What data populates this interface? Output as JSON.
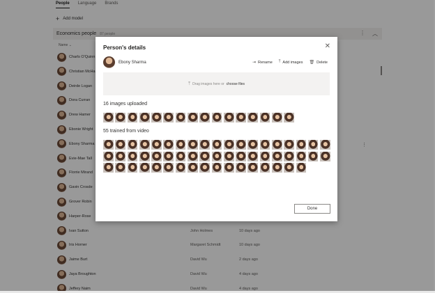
{
  "tabs": [
    {
      "label": "People",
      "active": true
    },
    {
      "label": "Language",
      "active": false
    },
    {
      "label": "Brands",
      "active": false
    }
  ],
  "add_model_label": "Add model",
  "group": {
    "title": "Economics people",
    "count": "87 people"
  },
  "column_header": "Name",
  "people": [
    {
      "name": "Charls O'Quinn",
      "owner": "",
      "when": ""
    },
    {
      "name": "Christian McHa",
      "owner": "",
      "when": ""
    },
    {
      "name": "Deirde Logan",
      "owner": "",
      "when": ""
    },
    {
      "name": "Dora Curran",
      "owner": "",
      "when": ""
    },
    {
      "name": "Drew Hamer",
      "owner": "",
      "when": ""
    },
    {
      "name": "Ebonie Wright",
      "owner": "",
      "when": ""
    },
    {
      "name": "Ebony Sharma",
      "owner": "",
      "when": ""
    },
    {
      "name": "Evie-Mae Tall",
      "owner": "",
      "when": ""
    },
    {
      "name": "Florrie Mirand",
      "owner": "",
      "when": ""
    },
    {
      "name": "Gavin Crosde",
      "owner": "",
      "when": ""
    },
    {
      "name": "Grover Robin",
      "owner": "",
      "when": ""
    },
    {
      "name": "Harper-Rose",
      "owner": "",
      "when": ""
    },
    {
      "name": "Ivan Sutton",
      "owner": "John Holmes",
      "when": "10 days ago"
    },
    {
      "name": "Iris Horner",
      "owner": "Margaret Schmidt",
      "when": "10 days ago"
    },
    {
      "name": "Jaime Burt",
      "owner": "David Wu",
      "when": "2 days ago"
    },
    {
      "name": "Jaya Broughton",
      "owner": "David Wu",
      "when": "4 days ago"
    },
    {
      "name": "Jeffery Naim",
      "owner": "David Wu",
      "when": "4 days ago"
    }
  ],
  "dialog": {
    "title": "Person's details",
    "person_name": "Ebony Sharma",
    "actions": [
      {
        "label": "Rename",
        "icon": "rename-icon",
        "glyph": "⇥"
      },
      {
        "label": "Add images",
        "icon": "upload-icon",
        "glyph": "⤒"
      },
      {
        "label": "Delete",
        "icon": "trash-icon",
        "glyph": "🗑"
      }
    ],
    "dropzone": {
      "text": "Drag images here or",
      "link": "choose files"
    },
    "uploaded": {
      "label": "16 images uploaded",
      "count": 16
    },
    "trained": {
      "label": "55 trained from video",
      "count": 55
    },
    "done_label": "Done"
  },
  "colors": {
    "overlay": "#000000",
    "dialog_bg": "#ffffff",
    "dropzone_bg": "#f3f2f1"
  }
}
